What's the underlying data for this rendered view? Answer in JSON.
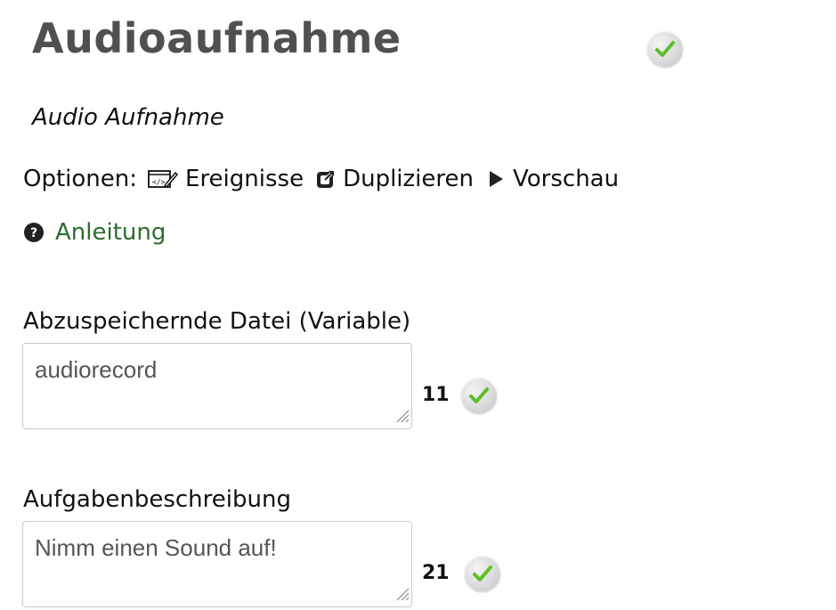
{
  "header": {
    "title": "Audioaufnahme",
    "subtitle": "Audio Aufnahme",
    "status_icon": "green-check-icon"
  },
  "options": {
    "label": "Optionen:",
    "items": [
      {
        "label": "Ereignisse",
        "icon": "code-edit-icon"
      },
      {
        "label": "Duplizieren",
        "icon": "duplicate-icon"
      },
      {
        "label": "Vorschau",
        "icon": "play-icon"
      }
    ]
  },
  "help": {
    "label": "Anleitung",
    "icon": "question-circle-icon"
  },
  "fields": [
    {
      "label": "Abzuspeichernde Datei (Variable)",
      "value": "audiorecord",
      "count": "11",
      "status_icon": "green-check-icon"
    },
    {
      "label": "Aufgabenbeschreibung",
      "value": "Nimm einen Sound auf!",
      "count": "21",
      "status_icon": "green-check-icon"
    }
  ],
  "colors": {
    "title": "#505050",
    "link": "#2f6b2f",
    "check": "#5cbf2a"
  }
}
